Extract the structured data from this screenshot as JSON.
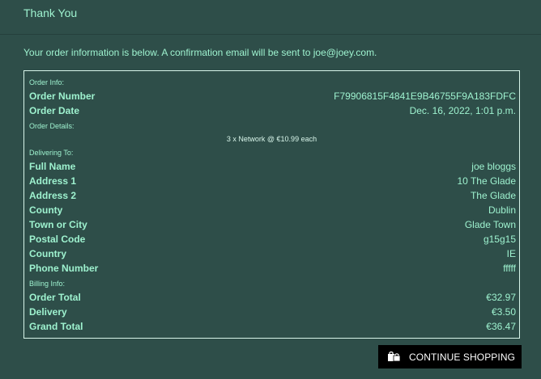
{
  "header": {
    "title": "Thank You"
  },
  "message": "Your order information is below. A confirmation email will be sent to joe@joey.com.",
  "order_info": {
    "section_label": "Order Info:",
    "rows": [
      {
        "label": "Order Number",
        "value": "F79906815F4841E9B46755F9A183FDFC"
      },
      {
        "label": "Order Date",
        "value": "Dec. 16, 2022, 1:01 p.m."
      }
    ]
  },
  "order_details": {
    "section_label": "Order Details:",
    "items": [
      "3 x Network @ €10.99 each"
    ]
  },
  "delivery": {
    "section_label": "Delivering To:",
    "rows": [
      {
        "label": "Full Name",
        "value": "joe bloggs"
      },
      {
        "label": "Address 1",
        "value": "10 The Glade"
      },
      {
        "label": "Address 2",
        "value": "The Glade"
      },
      {
        "label": "County",
        "value": "Dublin"
      },
      {
        "label": "Town or City",
        "value": "Glade Town"
      },
      {
        "label": "Postal Code",
        "value": "g15g15"
      },
      {
        "label": "Country",
        "value": "IE"
      },
      {
        "label": "Phone Number",
        "value": "fffff"
      }
    ]
  },
  "billing": {
    "section_label": "Billing Info:",
    "rows": [
      {
        "label": "Order Total",
        "value": "€32.97"
      },
      {
        "label": "Delivery",
        "value": "€3.50"
      },
      {
        "label": "Grand Total",
        "value": "€36.47"
      }
    ]
  },
  "actions": {
    "continue_label": "CONTINUE SHOPPING",
    "continue_icon": "shopping-bags-icon"
  },
  "colors": {
    "background": "#2e4e49",
    "text": "#9ef2cf",
    "border": "#d8f5ea",
    "button_bg": "#000000",
    "button_text": "#ffffff"
  }
}
